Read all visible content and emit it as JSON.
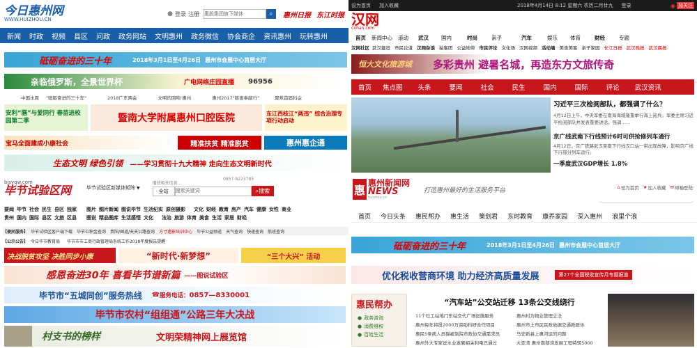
{
  "q1": {
    "logo": "今日惠州网",
    "logo_url": "WWW.HUIZHOU.CN",
    "login": "登录",
    "register": "注册",
    "search_placeholder": "惠股集团旗下媒体",
    "paper1": "惠州日报",
    "paper2": "东江时报",
    "nav": [
      "新闻",
      "时政",
      "视频",
      "县区",
      "问政",
      "政务网站",
      "文明惠州",
      "政务微信",
      "协会商企",
      "资讯惠州",
      "玩转惠州"
    ],
    "b1_text": "砥砺奋进的三十年",
    "b1_date": "2018年3月1日至4月26日",
    "b1_place": "惠州市会展中心首层大厅",
    "b2_text": "亲临俄罗斯，全景世界杯",
    "b2_right": "广电网络庄园直播",
    "b2_phone": "96956",
    "links": [
      "中国水周",
      "\"砥砺奋进的三十年\"",
      "2018广东两会",
      "文明的回响·惠州",
      "惠州2017\"慈善奉献行\"",
      "聚焦首届科企"
    ],
    "b3_left": "安利“膳”与爱同行 春苗进校园第二季",
    "b3_mid": "暨南大学附属惠州口腔医院",
    "b3_right": "东江西枝江“两违” 综合治理专项行动启动",
    "b4_a": "宝马全面建成小康社会",
    "b4_b": "精准扶贫  精准脱贫",
    "b4_c": "惠州惠企通",
    "b5_text": "生态文明  绿色引领",
    "b5_sub": "——学习贯彻十九大精神  走向生态文明新时代"
  },
  "q2": {
    "date": "2018年4月14日 8:12 星期六 农历二月廿九",
    "login": "登录",
    "links_top": [
      "设为首页",
      "加入收藏"
    ],
    "weibo": "加关注",
    "logo": "汉网",
    "logo_url": "cnhan.com",
    "nav1": [
      "首页",
      "新闻中心",
      "滚动",
      "武汉",
      "国内",
      "时尚",
      "亲子",
      "汽车",
      "娱乐",
      "体育",
      "财经",
      "专题"
    ],
    "nav2": [
      "汉网社区",
      "武汉建设",
      "市民论道",
      "汉网杂谈",
      "拍客团",
      "公益地带",
      "市民评论",
      "文化场",
      "汉网视频",
      "活动墙",
      "美食美客",
      "亲子家园",
      "长江日报",
      "武汉晚报",
      "武汉晨报"
    ],
    "banner_left": "恒大文化旅游城",
    "banner_main": "多彩贵州 避暑名城，再造东方文旅传奇",
    "tabs": [
      "首页",
      "焦点图",
      "头条",
      "要闻",
      "社会",
      "民生",
      "国内",
      "国际",
      "评论",
      "武汉资讯"
    ],
    "headline": "习近平三次检阅部队，都强调了什么？",
    "para1": "4月12日上午，中央军委在南海海域隆重举行海上阅兵。军委主席习近平检阅部队并发表重要讲话，强调……",
    "news2": "京广线武南下行线预计6时可供抢修列车通行",
    "para2": "4月12日，京广铁路武汉至南下行线汉口站一带出现故障，影响京广线下行部分列车运行。",
    "news3": "一季度武汉GDP增长 1.8%"
  },
  "q3": {
    "logo": "毕节试验区网",
    "logo_url": "bjsyqw.com",
    "site_nav": "毕节试验区新媒体矩阵",
    "tip": "播放相关信息...",
    "phone": "0857-8223785",
    "search_scope": "全站",
    "search_placeholder": "搜索关键词",
    "search_btn": "搜索",
    "nav_rows": [
      [
        "要闻",
        "毕节",
        "社会",
        "民生",
        "县区",
        "独家",
        "图片",
        "图片新闻",
        "图说毕节",
        "生活纪实",
        "原创摄影",
        "文化",
        "财经",
        "教育",
        "房产",
        "汽车",
        "健康",
        "女性",
        "商业"
      ],
      [
        "贵州",
        "国内",
        "国际",
        "县区",
        "文旅",
        "区县",
        "图说",
        "精品图库",
        "生活感悟",
        "文化",
        "法治",
        "旅游",
        "体育",
        "美食",
        "生活",
        "家居",
        "财经"
      ]
    ],
    "service_label": "【便民服务】",
    "service": [
      "毕节试验区客户端下载",
      "毕节公积金查询",
      "贵阳/国道/天天公路查询",
      "方寸遗影培训中心",
      "毕节公益频道",
      "天气查询",
      "快递查询",
      "航班查询"
    ],
    "announce_label": "【公示公告】",
    "announce": "今日毕节教育局",
    "announce2": "毕节市市工商行政管理局系统工作2018年度报告提醒",
    "b1_left": "决战脱贫攻坚 决胜同步小康",
    "b1_mid": "“新时代·新梦想”",
    "b1_right": "“三个大兴” 活动",
    "b2": "感恩奋进30年  喜看毕节谱新篇",
    "b2_sub": "——图说试验区",
    "b3": "毕节市“五城同创”服务热线",
    "b3_phone": "0857—8330001",
    "b3_service": "服务电话：",
    "b4": "毕节市农村“组组通”公路三年大决战",
    "b5_left": "村支书的榜样",
    "b5_right": "文明荣精神网上展览馆"
  },
  "q4": {
    "logo": "惠州新闻网",
    "logo_en": "NEWS",
    "logo_url": "huizhou.cn",
    "slogan": "打造惠州最好的生活服务平台",
    "links_top": [
      "设为首页",
      "加入收藏",
      "邮箱登陆"
    ],
    "tabs": [
      "首页",
      "今日头条",
      "惠民帮办",
      "惠生活",
      "策划君",
      "东时教育",
      "康养家园",
      "深入惠州",
      "浪里个浪"
    ],
    "b1_text": "砥砺奋进的三十年",
    "b1_date": "2018年3月1日至4月26日",
    "b1_place": "惠州市会展中心首层大厅",
    "b2_text": "优化税收营商环境 助力经济高质量发展",
    "b2_sub": "第27个全国税收宣传月专题报道",
    "side_title": "惠民帮办",
    "side_items": [
      "政务咨询",
      "消费维权",
      "百姓生活"
    ],
    "headline": "“汽车站”公交站迁移 13条公交线绕行",
    "news": [
      [
        "11个社工站地门东站交代广场设施服务",
        "惠州村为物业管理立法"
      ],
      [
        "惠州每年将投2000万资助科研合作项目",
        "惠州市上市区民政依据交通新群体"
      ],
      [
        "惠民5条病人员猫被到院市政协交通需求员",
        "马安新县上惠河运的问题"
      ],
      [
        "惠州外大专家说水业发展相关利电已通过",
        "大亚湾 惠州南部湾发展工程特转5000"
      ]
    ]
  }
}
